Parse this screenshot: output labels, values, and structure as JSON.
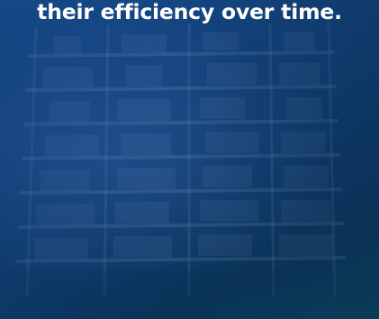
{
  "headline": {
    "text": "their efficiency over time."
  },
  "background": {
    "image": "shelving-storage-photo",
    "tint": "#123f76"
  },
  "colors": {
    "headline_text": "#ffffff",
    "gradient_top": "#174b8c",
    "gradient_bottom": "#0b4a5e"
  }
}
